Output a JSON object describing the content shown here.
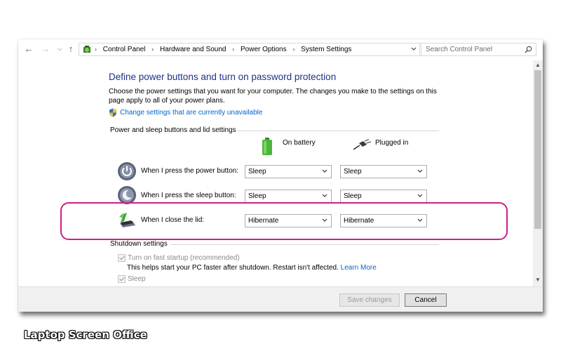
{
  "breadcrumb": [
    "Control Panel",
    "Hardware and Sound",
    "Power Options",
    "System Settings"
  ],
  "search": {
    "placeholder": "Search Control Panel"
  },
  "page": {
    "title": "Define power buttons and turn on password protection",
    "description": "Choose the power settings that you want for your computer. The changes you make to the settings on this page apply to all of your power plans.",
    "change_settings_link": "Change settings that are currently unavailable"
  },
  "power_section": {
    "header": "Power and sleep buttons and lid settings",
    "on_battery_label": "On battery",
    "plugged_in_label": "Plugged in",
    "rows": [
      {
        "label": "When I press the power button:",
        "on_battery": "Sleep",
        "plugged_in": "Sleep",
        "icon": "power-button-icon"
      },
      {
        "label": "When I press the sleep button:",
        "on_battery": "Sleep",
        "plugged_in": "Sleep",
        "icon": "sleep-button-icon"
      },
      {
        "label": "When I close the lid:",
        "on_battery": "Hibernate",
        "plugged_in": "Hibernate",
        "icon": "laptop-lid-icon"
      }
    ]
  },
  "shutdown_section": {
    "header": "Shutdown settings",
    "fast_startup": {
      "label": "Turn on fast startup (recommended)",
      "checked": true,
      "disabled": true
    },
    "fast_startup_desc": "This helps start your PC faster after shutdown. Restart isn't affected.",
    "learn_more": "Learn More",
    "sleep": {
      "label": "Sleep",
      "checked": true,
      "disabled": true
    }
  },
  "footer": {
    "save_label": "Save changes",
    "cancel_label": "Cancel"
  },
  "watermark": "Laptop Screen Office",
  "colors": {
    "title": "#1e3287",
    "link": "#0066cc",
    "highlight": "#cc1f8a"
  }
}
